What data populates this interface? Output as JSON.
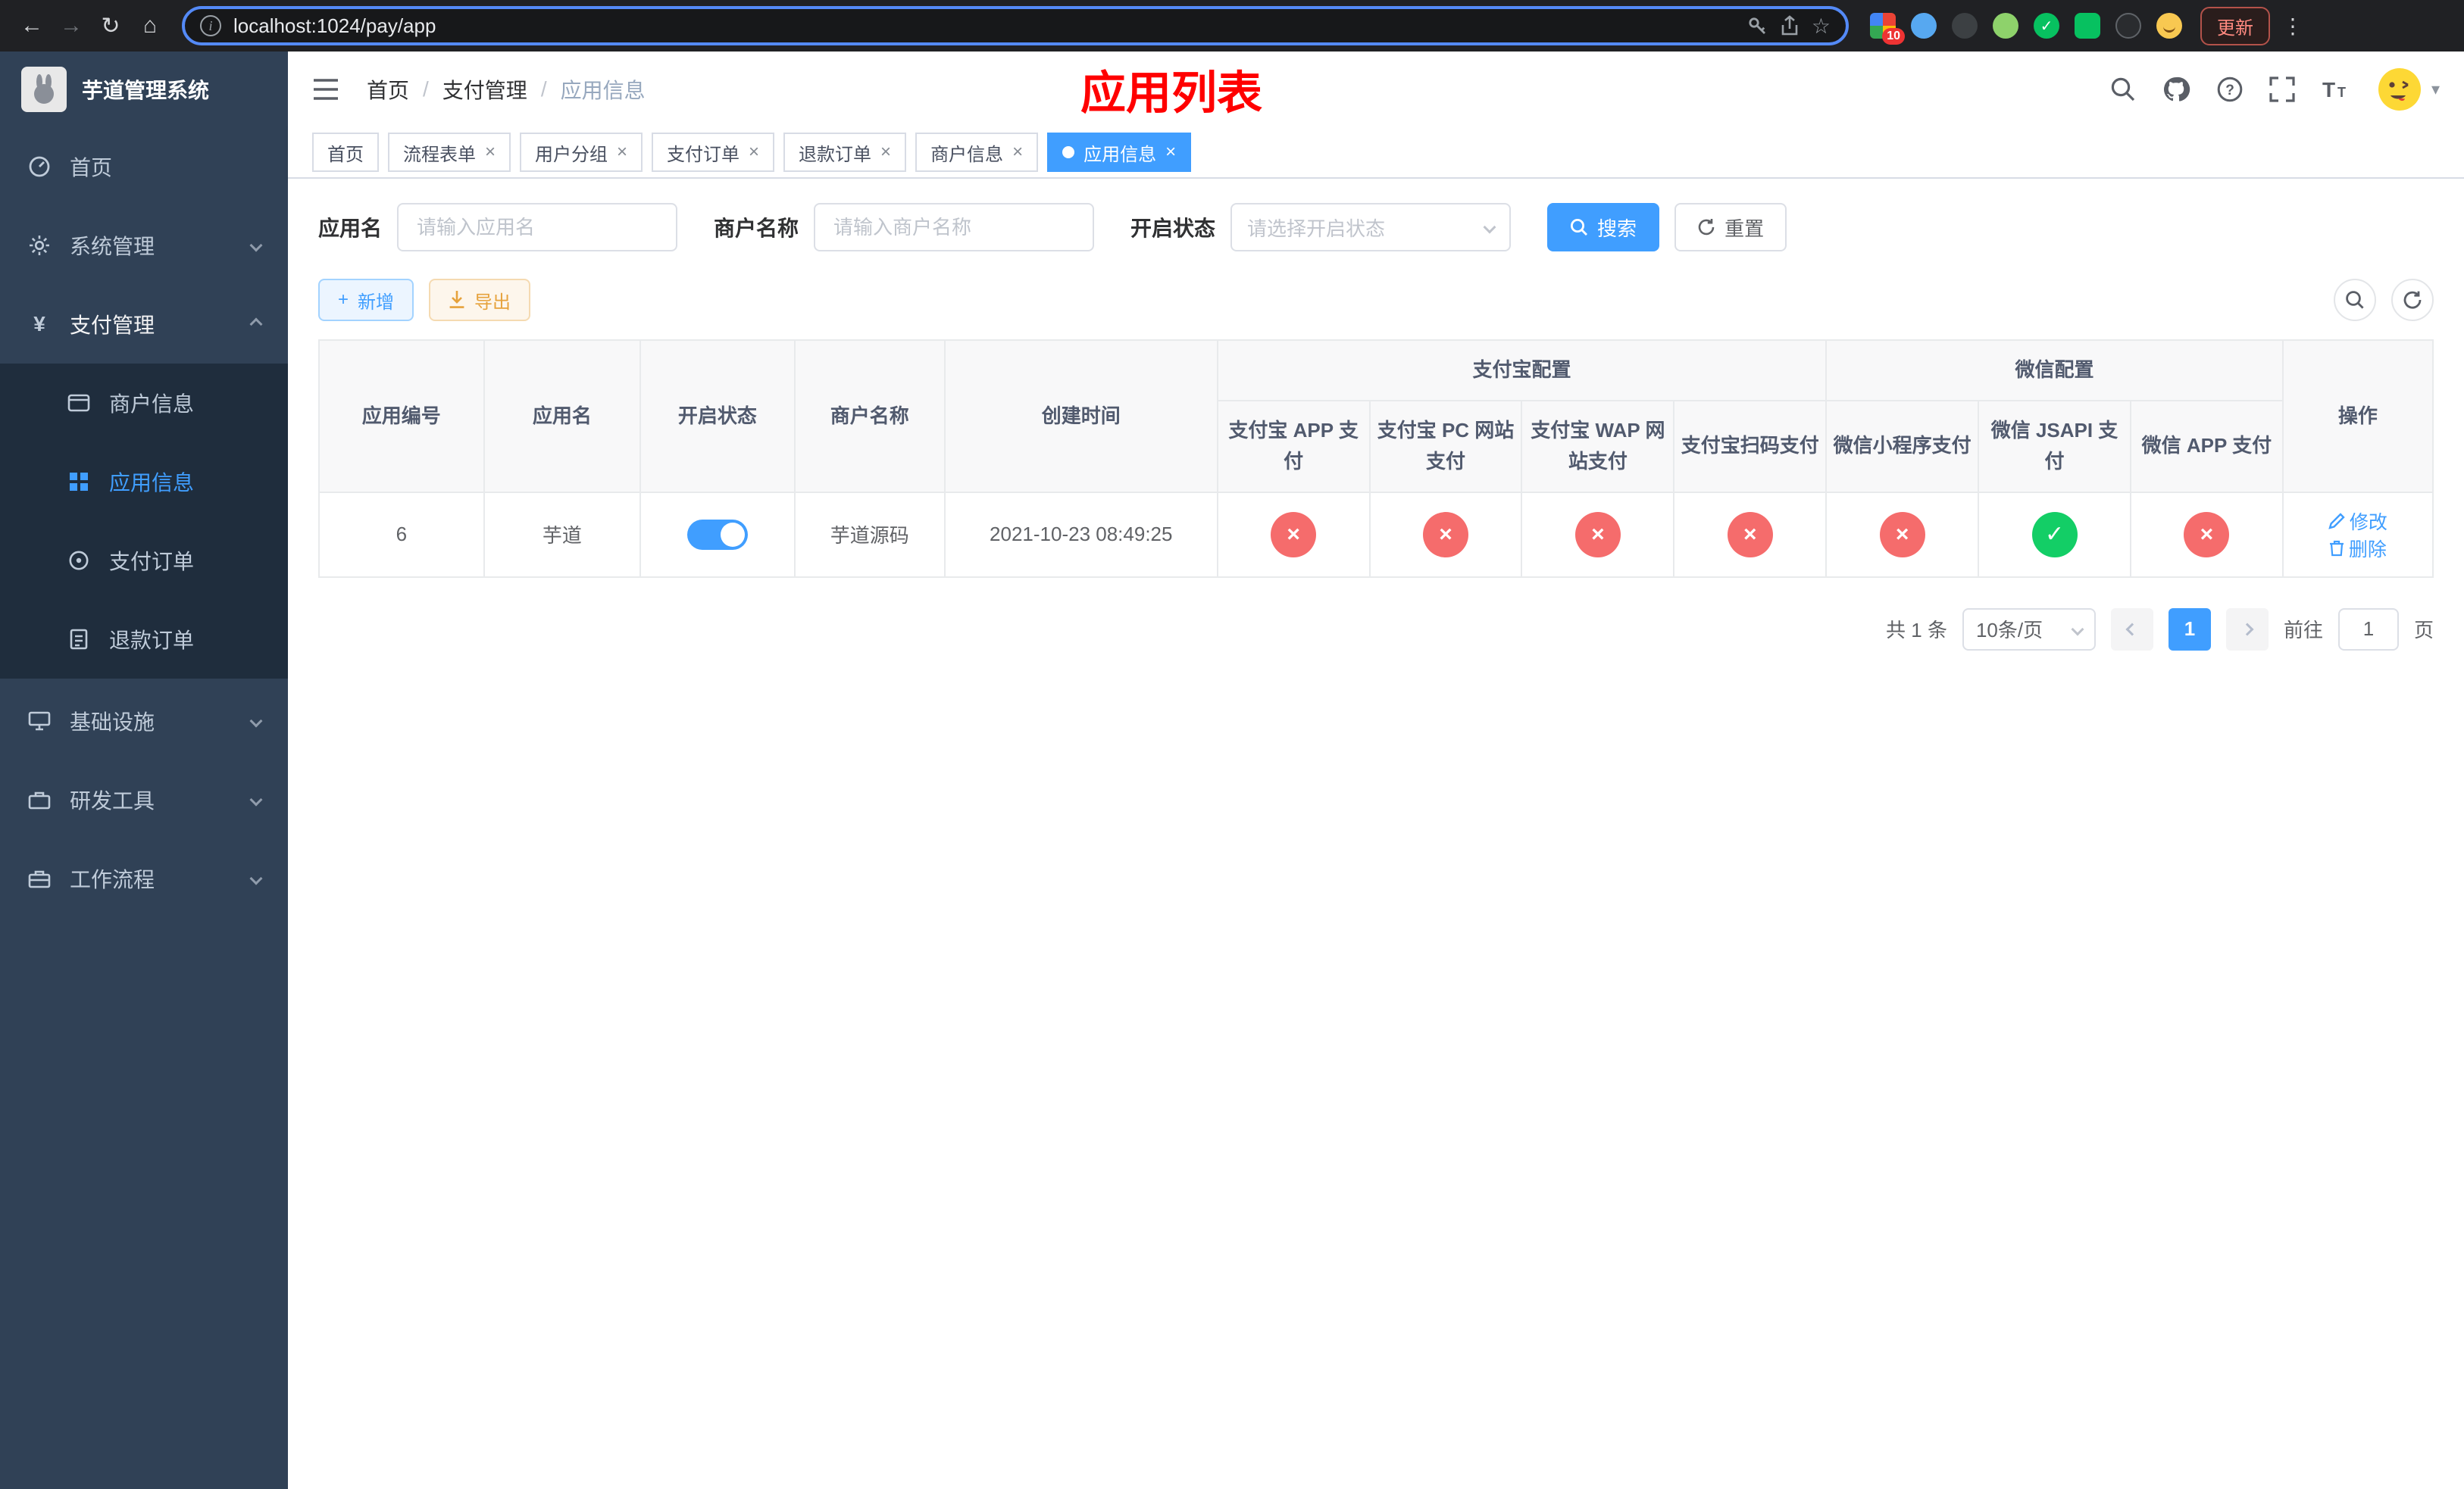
{
  "icons": {
    "back": "←",
    "forward": "→",
    "reload": "↻",
    "home": "⌂",
    "star": "☆",
    "kebab": "⋮",
    "close": "×",
    "check": "✓",
    "cross": "×",
    "caret_down": "▾",
    "yen": "¥",
    "question": "?",
    "plus": "+",
    "info": "i"
  },
  "browser": {
    "url": "localhost:1024/pay/app",
    "extension_badge": "10",
    "update_button": "更新"
  },
  "sidebar": {
    "app_title": "芋道管理系统",
    "items": [
      {
        "label": "首页"
      },
      {
        "label": "系统管理"
      },
      {
        "label": "支付管理"
      },
      {
        "label": "基础设施"
      },
      {
        "label": "研发工具"
      },
      {
        "label": "工作流程"
      }
    ],
    "pay_submenu": [
      {
        "label": "商户信息"
      },
      {
        "label": "应用信息",
        "active": true
      },
      {
        "label": "支付订单"
      },
      {
        "label": "退款订单"
      }
    ]
  },
  "header": {
    "breadcrumb": [
      "首页",
      "支付管理",
      "应用信息"
    ],
    "page_title": "应用列表"
  },
  "tabs": [
    {
      "label": "首页"
    },
    {
      "label": "流程表单"
    },
    {
      "label": "用户分组"
    },
    {
      "label": "支付订单"
    },
    {
      "label": "退款订单"
    },
    {
      "label": "商户信息"
    },
    {
      "label": "应用信息",
      "active": true
    }
  ],
  "filter": {
    "app_name_label": "应用名",
    "app_name_placeholder": "请输入应用名",
    "merchant_label": "商户名称",
    "merchant_placeholder": "请输入商户名称",
    "status_label": "开启状态",
    "status_placeholder": "请选择开启状态",
    "search_button": "搜索",
    "reset_button": "重置"
  },
  "toolbar": {
    "add_button": "新增",
    "export_button": "导出"
  },
  "table": {
    "columns": {
      "id": "应用编号",
      "name": "应用名",
      "status": "开启状态",
      "merchant": "商户名称",
      "created": "创建时间",
      "actions": "操作"
    },
    "groups": {
      "alipay": "支付宝配置",
      "wechat": "微信配置"
    },
    "config_columns": [
      "支付宝 APP 支付",
      "支付宝 PC 网站支付",
      "支付宝 WAP 网站支付",
      "支付宝扫码支付",
      "微信小程序支付",
      "微信 JSAPI 支付",
      "微信 APP 支付"
    ],
    "rows": [
      {
        "id": "6",
        "name": "芋道",
        "status_on": true,
        "merchant": "芋道源码",
        "created": "2021-10-23 08:49:25",
        "configs": [
          false,
          false,
          false,
          false,
          false,
          true,
          false
        ],
        "edit_label": "修改",
        "delete_label": "删除"
      }
    ]
  },
  "pagination": {
    "total": "共 1 条",
    "page_size": "10条/页",
    "current_page": "1",
    "goto_label": "前往",
    "goto_value": "1",
    "goto_suffix": "页"
  },
  "colors": {
    "accent": "#409eff",
    "danger": "#f56c6c",
    "success": "#13ce66",
    "warning": "#e6a23c",
    "title_red": "#ff0000",
    "sidebar_bg": "#304156",
    "sidebar_sub_bg": "#1f2d3d"
  }
}
